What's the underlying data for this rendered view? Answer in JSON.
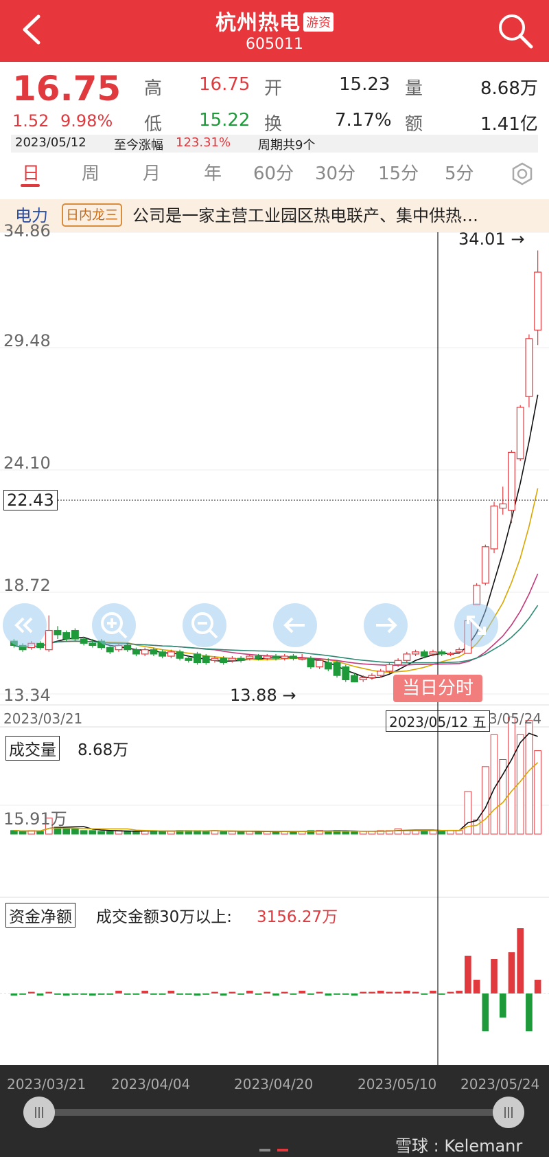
{
  "header": {
    "title": "杭州热电",
    "badge": "游资",
    "code": "605011"
  },
  "quote": {
    "price": "16.75",
    "change": "1.52",
    "change_pct": "9.98%",
    "high_label": "高",
    "high": "16.75",
    "open_label": "开",
    "open": "15.23",
    "volume_label": "量",
    "volume": "8.68万",
    "low_label": "低",
    "low": "15.22",
    "turnover_label": "换",
    "turnover": "7.17%",
    "amount_label": "额",
    "amount": "1.41亿",
    "date": "2023/05/12",
    "since_label": "至今涨幅",
    "since_value": "123.31%",
    "period_text": "周期共9个"
  },
  "tabs": [
    "日",
    "周",
    "月",
    "年",
    "60分",
    "30分",
    "15分",
    "5分"
  ],
  "banner": {
    "sector": "电力",
    "rank": "日内龙三",
    "desc": "公司是一家主营工业园区热电联产、集中供热…"
  },
  "kline": {
    "y_labels": [
      "34.86",
      "29.48",
      "24.10",
      "18.72",
      "13.34"
    ],
    "crosshair_price": "22.43",
    "max_label": "34.01 →",
    "min_label": "13.88 →",
    "intraday_button": "当日分时",
    "start_date": "2023/03/21",
    "crosshair_date": "2023/05/12 五",
    "end_date": "3/05/24"
  },
  "volume": {
    "label": "成交量",
    "value": "8.68万",
    "y_label": "15.91万"
  },
  "fund": {
    "label": "资金净额",
    "text": "成交金额30万以上:",
    "value": "3156.27万"
  },
  "timeline": [
    "2023/03/21",
    "2023/04/04",
    "2023/04/20",
    "2023/05/10",
    "2023/05/24"
  ],
  "watermark": "雪球 : Kelemanr",
  "colors": {
    "header": "#e8373c",
    "up": "#e0393e",
    "down": "#1e9a3a"
  },
  "chart_data": {
    "type": "candlestick",
    "title": "",
    "ylim": [
      13.34,
      34.86
    ],
    "x_range": [
      "2023/03/21",
      "2023/05/24"
    ],
    "candles": [
      {
        "o": 15.8,
        "c": 15.6,
        "h": 15.9,
        "l": 15.5
      },
      {
        "o": 15.6,
        "c": 15.4,
        "h": 15.7,
        "l": 15.3
      },
      {
        "o": 15.5,
        "c": 15.7,
        "h": 15.8,
        "l": 15.4
      },
      {
        "o": 15.7,
        "c": 15.5,
        "h": 15.8,
        "l": 15.4
      },
      {
        "o": 15.4,
        "c": 16.3,
        "h": 17.0,
        "l": 15.3
      },
      {
        "o": 16.3,
        "c": 16.1,
        "h": 16.5,
        "l": 15.9
      },
      {
        "o": 16.2,
        "c": 15.9,
        "h": 16.3,
        "l": 15.8
      },
      {
        "o": 16.3,
        "c": 15.9,
        "h": 16.4,
        "l": 15.8
      },
      {
        "o": 15.9,
        "c": 15.7,
        "h": 16.0,
        "l": 15.6
      },
      {
        "o": 15.7,
        "c": 15.6,
        "h": 15.9,
        "l": 15.5
      },
      {
        "o": 15.8,
        "c": 15.5,
        "h": 15.9,
        "l": 15.4
      },
      {
        "o": 15.5,
        "c": 15.3,
        "h": 15.6,
        "l": 15.2
      },
      {
        "o": 15.4,
        "c": 15.6,
        "h": 15.7,
        "l": 15.3
      },
      {
        "o": 15.6,
        "c": 15.4,
        "h": 15.7,
        "l": 15.3
      },
      {
        "o": 15.4,
        "c": 15.2,
        "h": 15.5,
        "l": 15.1
      },
      {
        "o": 15.2,
        "c": 15.4,
        "h": 15.5,
        "l": 15.1
      },
      {
        "o": 15.4,
        "c": 15.2,
        "h": 15.5,
        "l": 15.1
      },
      {
        "o": 15.3,
        "c": 15.1,
        "h": 15.4,
        "l": 15.0
      },
      {
        "o": 15.1,
        "c": 15.3,
        "h": 15.4,
        "l": 15.0
      },
      {
        "o": 15.3,
        "c": 15.0,
        "h": 15.4,
        "l": 14.9
      },
      {
        "o": 15.0,
        "c": 14.9,
        "h": 15.1,
        "l": 14.8
      },
      {
        "o": 15.2,
        "c": 14.8,
        "h": 15.3,
        "l": 14.7
      },
      {
        "o": 15.1,
        "c": 14.8,
        "h": 15.2,
        "l": 14.7
      },
      {
        "o": 14.9,
        "c": 15.0,
        "h": 15.1,
        "l": 14.8
      },
      {
        "o": 15.0,
        "c": 14.8,
        "h": 15.1,
        "l": 14.7
      },
      {
        "o": 14.9,
        "c": 15.0,
        "h": 15.1,
        "l": 14.8
      },
      {
        "o": 15.0,
        "c": 14.9,
        "h": 15.1,
        "l": 14.8
      },
      {
        "o": 15.0,
        "c": 15.1,
        "h": 15.2,
        "l": 14.9
      },
      {
        "o": 15.1,
        "c": 15.0,
        "h": 15.2,
        "l": 14.9
      },
      {
        "o": 15.0,
        "c": 15.1,
        "h": 15.2,
        "l": 14.9
      },
      {
        "o": 15.1,
        "c": 15.0,
        "h": 15.2,
        "l": 14.9
      },
      {
        "o": 15.0,
        "c": 15.1,
        "h": 15.2,
        "l": 14.9
      },
      {
        "o": 15.1,
        "c": 15.0,
        "h": 15.2,
        "l": 14.9
      },
      {
        "o": 15.0,
        "c": 15.0,
        "h": 15.2,
        "l": 14.9
      },
      {
        "o": 15.0,
        "c": 14.6,
        "h": 15.1,
        "l": 14.5
      },
      {
        "o": 14.6,
        "c": 14.9,
        "h": 15.0,
        "l": 14.5
      },
      {
        "o": 14.8,
        "c": 14.5,
        "h": 15.0,
        "l": 14.4
      },
      {
        "o": 14.8,
        "c": 14.2,
        "h": 14.9,
        "l": 14.1
      },
      {
        "o": 14.6,
        "c": 14.0,
        "h": 14.7,
        "l": 13.9
      },
      {
        "o": 14.2,
        "c": 13.9,
        "h": 14.3,
        "l": 13.88
      },
      {
        "o": 14.0,
        "c": 14.1,
        "h": 14.2,
        "l": 13.9
      },
      {
        "o": 14.1,
        "c": 14.2,
        "h": 14.3,
        "l": 14.0
      },
      {
        "o": 14.2,
        "c": 14.4,
        "h": 14.5,
        "l": 14.1
      },
      {
        "o": 14.4,
        "c": 14.7,
        "h": 14.8,
        "l": 14.3
      },
      {
        "o": 14.7,
        "c": 14.9,
        "h": 15.0,
        "l": 14.6
      },
      {
        "o": 14.9,
        "c": 15.2,
        "h": 15.3,
        "l": 14.8
      },
      {
        "o": 15.2,
        "c": 15.3,
        "h": 15.4,
        "l": 15.1
      },
      {
        "o": 15.3,
        "c": 15.1,
        "h": 15.4,
        "l": 15.0
      },
      {
        "o": 15.2,
        "c": 15.3,
        "h": 15.4,
        "l": 15.1
      },
      {
        "o": 15.3,
        "c": 15.2,
        "h": 15.4,
        "l": 15.1
      },
      {
        "o": 15.2,
        "c": 15.23,
        "h": 15.3,
        "l": 15.1
      },
      {
        "o": 15.3,
        "c": 15.4,
        "h": 15.5,
        "l": 15.2
      },
      {
        "o": 15.23,
        "c": 16.75,
        "h": 16.75,
        "l": 15.22
      },
      {
        "o": 17.5,
        "c": 18.4,
        "h": 18.5,
        "l": 17.5
      },
      {
        "o": 18.5,
        "c": 20.2,
        "h": 20.3,
        "l": 18.4
      },
      {
        "o": 20.1,
        "c": 22.1,
        "h": 22.3,
        "l": 19.9
      },
      {
        "o": 22.0,
        "c": 22.2,
        "h": 23.0,
        "l": 21.7
      },
      {
        "o": 21.9,
        "c": 24.6,
        "h": 24.7,
        "l": 21.3
      },
      {
        "o": 24.3,
        "c": 26.7,
        "h": 26.8,
        "l": 24.2
      },
      {
        "o": 27.2,
        "c": 29.9,
        "h": 30.1,
        "l": 26.7
      },
      {
        "o": 30.3,
        "c": 33.0,
        "h": 34.01,
        "l": 29.6
      }
    ],
    "crosshair_index": 52,
    "volume_max_label": "15.91万",
    "volumes": [
      0.2,
      0.15,
      0.2,
      0.15,
      0.9,
      0.4,
      0.3,
      0.3,
      0.2,
      0.2,
      0.15,
      0.15,
      0.2,
      0.15,
      0.15,
      0.2,
      0.2,
      0.15,
      0.15,
      0.2,
      0.2,
      0.2,
      0.15,
      0.2,
      0.15,
      0.15,
      0.15,
      0.15,
      0.15,
      0.15,
      0.15,
      0.15,
      0.15,
      0.15,
      0.2,
      0.2,
      0.15,
      0.2,
      0.15,
      0.15,
      0.15,
      0.15,
      0.2,
      0.2,
      0.3,
      0.2,
      0.2,
      0.2,
      0.2,
      0.2,
      0.2,
      0.2,
      2.4,
      0.8,
      3.8,
      5.6,
      4.2,
      6.6,
      5.6,
      6.4,
      4.7
    ]
  }
}
